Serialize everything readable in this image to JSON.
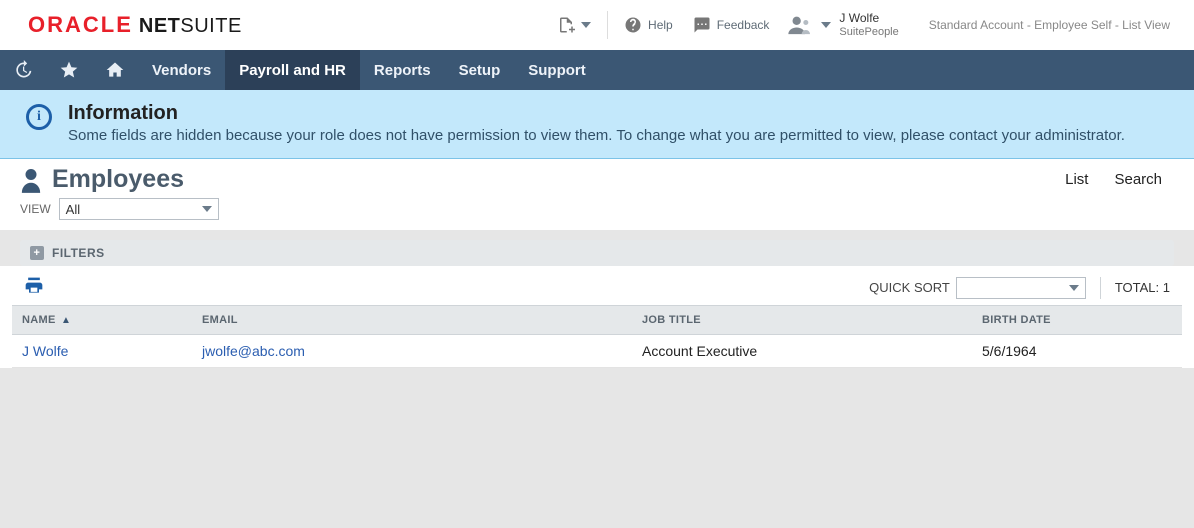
{
  "header": {
    "logo_oracle": "ORACLE",
    "logo_ns1": "NET",
    "logo_ns2": "SUITE",
    "help_label": "Help",
    "feedback_label": "Feedback",
    "user": {
      "name": "J Wolfe",
      "role": "SuitePeople"
    },
    "crumb": "Standard Account - Employee Self - List View"
  },
  "nav": {
    "items": [
      {
        "label": "Vendors",
        "active": false
      },
      {
        "label": "Payroll and HR",
        "active": true
      },
      {
        "label": "Reports",
        "active": false
      },
      {
        "label": "Setup",
        "active": false
      },
      {
        "label": "Support",
        "active": false
      }
    ]
  },
  "banner": {
    "title": "Information",
    "body": "Some fields are hidden because your role does not have permission to view them. To change what you are permitted to view, please contact your administrator."
  },
  "page": {
    "title": "Employees",
    "links": {
      "list": "List",
      "search": "Search"
    },
    "view_label": "VIEW",
    "view_value": "All",
    "filters_label": "FILTERS"
  },
  "toolbar": {
    "quicksort_label": "QUICK SORT",
    "quicksort_value": "",
    "total_label": "TOTAL:",
    "total_value": "1"
  },
  "table": {
    "columns": {
      "name": "NAME",
      "email": "EMAIL",
      "job_title": "JOB TITLE",
      "birth_date": "BIRTH DATE"
    },
    "rows": [
      {
        "name": "J Wolfe",
        "email": "jwolfe@abc.com",
        "job_title": "Account Executive",
        "birth_date": "5/6/1964"
      }
    ]
  }
}
